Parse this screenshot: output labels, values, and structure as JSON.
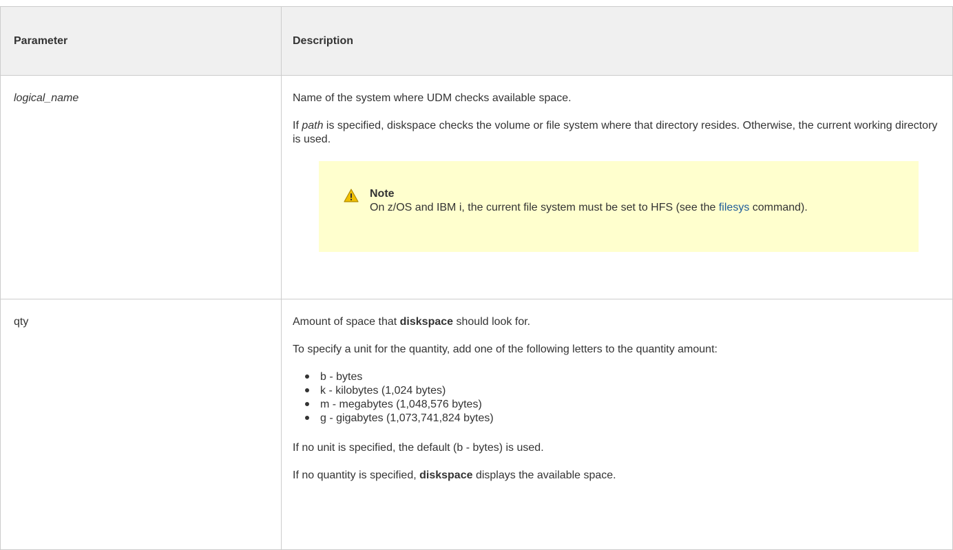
{
  "table": {
    "headers": {
      "parameter": "Parameter",
      "description": "Description"
    },
    "rows": [
      {
        "param": "logical_name",
        "desc_line1": "Name of the system where UDM checks available space.",
        "desc_line2_em": "path",
        "desc_line2_rest": " is specified, diskspace checks the volume or file system where that directory resides. Otherwise, the current working directory is used.",
        "desc_line2_prefix": "If ",
        "note": {
          "title": "Note",
          "text_before": "On z/OS and IBM i, the current file system must be set to HFS (see the ",
          "link": "filesys",
          "text_after": " command)."
        }
      },
      {
        "param": "qty",
        "p1_before": "Amount of space that ",
        "p1_bold": "diskspace",
        "p1_after": " should look for.",
        "p2": "To specify a unit for the quantity, add one of the following letters to the quantity amount:",
        "units": [
          "b - bytes",
          "k - kilobytes (1,024 bytes)",
          "m - megabytes (1,048,576 bytes)",
          "g - gigabytes (1,073,741,824 bytes)"
        ],
        "p3": "If no unit is specified, the default (b - bytes) is used.",
        "p4_before": "If no quantity is specified, ",
        "p4_bold": "diskspace",
        "p4_after": " displays the available space."
      }
    ]
  },
  "colors": {
    "header_bg": "#f0f0f0",
    "border": "#cccccc",
    "note_bg": "#ffffce",
    "link": "#1f5c99",
    "warning_icon": "#f0c000"
  },
  "icons": {
    "note": "warning-icon"
  }
}
